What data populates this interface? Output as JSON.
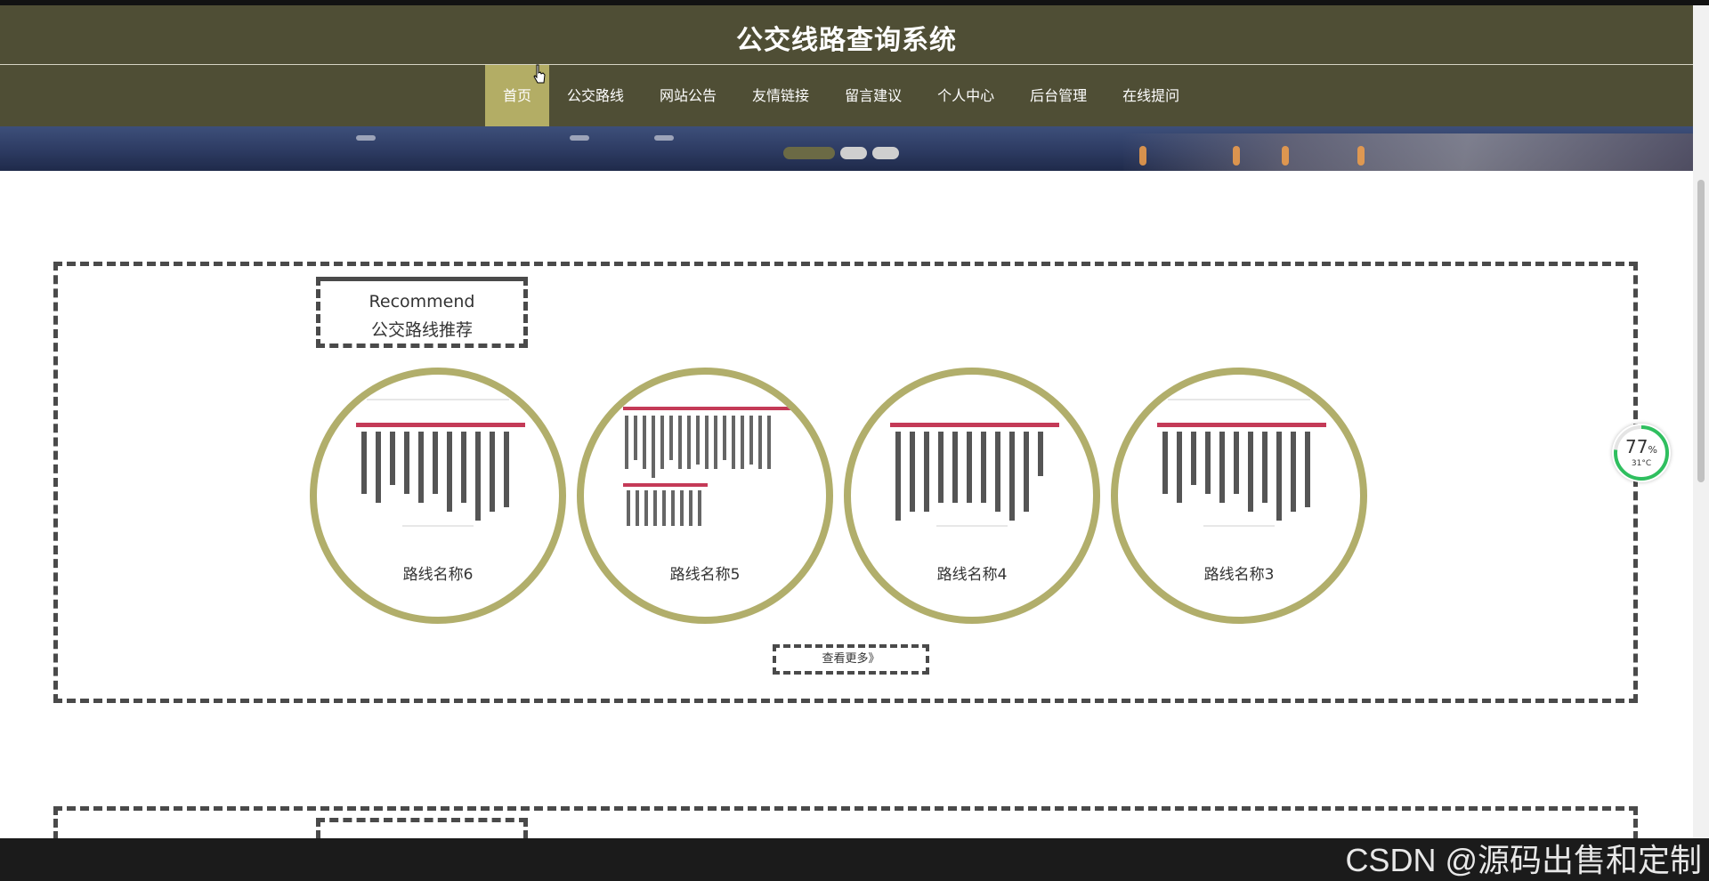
{
  "site": {
    "title": "公交线路查询系统"
  },
  "nav": {
    "items": [
      {
        "label": "首页",
        "active": true
      },
      {
        "label": "公交路线",
        "active": false
      },
      {
        "label": "网站公告",
        "active": false
      },
      {
        "label": "友情链接",
        "active": false
      },
      {
        "label": "留言建议",
        "active": false
      },
      {
        "label": "个人中心",
        "active": false
      },
      {
        "label": "后台管理",
        "active": false
      },
      {
        "label": "在线提问",
        "active": false
      }
    ]
  },
  "banner": {
    "slide_count": 3,
    "active_slide": 1
  },
  "recommend": {
    "heading_en": "Recommend",
    "heading_zh": "公交路线推荐",
    "routes": [
      {
        "name": "路线名称6"
      },
      {
        "name": "路线名称5"
      },
      {
        "name": "路线名称4"
      },
      {
        "name": "路线名称3"
      }
    ],
    "more_label": "查看更多》"
  },
  "widget": {
    "percent": "77",
    "percent_sign": "%",
    "temperature": "31°C"
  },
  "watermark": "CSDN @源码出售和定制",
  "colors": {
    "header_bg": "#4f4e35",
    "nav_active": "#b3ad65",
    "card_ring": "#b1ae6b"
  }
}
